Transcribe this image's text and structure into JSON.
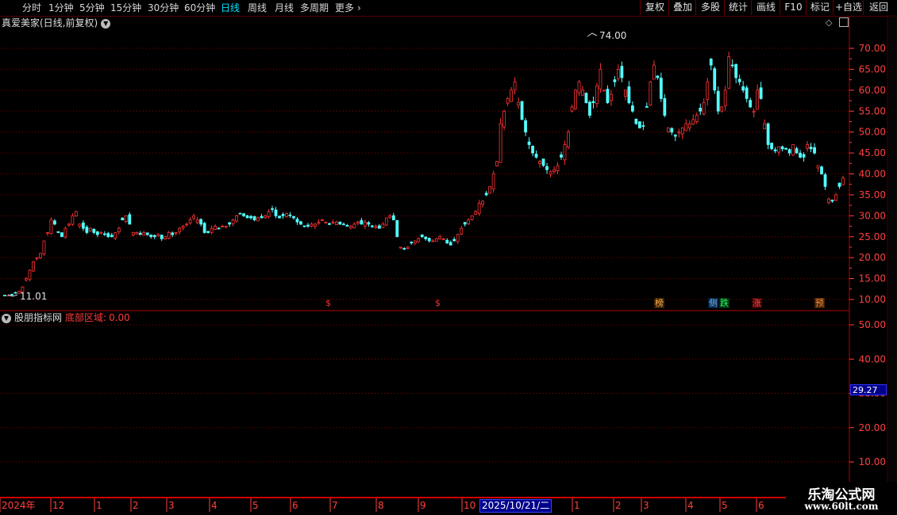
{
  "toolbar": {
    "periods": [
      "分时",
      "1分钟",
      "5分钟",
      "15分钟",
      "30分钟",
      "60分钟",
      "日线",
      "周线",
      "月线",
      "多周期",
      "更多"
    ],
    "active_period": "日线",
    "right_buttons": [
      "复权",
      "叠加",
      "多股",
      "统计",
      "画线",
      "F10",
      "标记",
      "+自选",
      "返回"
    ]
  },
  "main_chart": {
    "stock_title": "真爱美家(日线,前复权)",
    "high_label": "74.00",
    "low_label": "11.01",
    "markers": [
      {
        "text": "$",
        "color": "#ff3030"
      },
      {
        "text": "$",
        "color": "#ff3030"
      },
      {
        "text": "榜",
        "color": "#ffb050"
      },
      {
        "text": "侧",
        "color": "#80c0ff"
      },
      {
        "text": "跌",
        "color": "#30ff60"
      },
      {
        "text": "涨",
        "color": "#ff5050"
      },
      {
        "text": "预",
        "color": "#ff9040"
      }
    ]
  },
  "indicator": {
    "name": "股朋指标网",
    "param_label": "底部区域:",
    "param_value": "0.00",
    "current_value": "29.27"
  },
  "date_axis": {
    "labels": [
      "2024年",
      "12",
      "1",
      "2",
      "3",
      "4",
      "5",
      "6",
      "7",
      "8",
      "9",
      "10",
      "1",
      "2",
      "3",
      "4",
      "5",
      "6"
    ],
    "cursor_date": "2025/10/21/二"
  },
  "watermark": {
    "title": "乐淘公式网",
    "url": "www.60lt.com"
  },
  "colors": {
    "up": "#ff3232",
    "down": "#54ffff",
    "grid": "#8b0000",
    "axis": "#ff4040"
  },
  "chart_data": {
    "type": "candlestick",
    "price_axis": {
      "ticks": [
        10,
        15,
        20,
        25,
        30,
        35,
        40,
        45,
        50,
        55,
        60,
        65,
        70
      ],
      "ylim": [
        7.5,
        76
      ]
    },
    "indicator_axis": {
      "ticks": [
        10,
        20,
        30,
        40,
        50
      ]
    },
    "series_close_approx": [
      11,
      11,
      11.2,
      11.5,
      12,
      13,
      15,
      17,
      19,
      20,
      21,
      24,
      26,
      29,
      28,
      26,
      25,
      27,
      28,
      30,
      31,
      28,
      27,
      26,
      27,
      26,
      25.5,
      26,
      25.5,
      25,
      25,
      26,
      27,
      29,
      30,
      28,
      26,
      26,
      25.5,
      26,
      25.5,
      25,
      25,
      25.5,
      24.5,
      25,
      26,
      25.5,
      26,
      27,
      27.5,
      28,
      29,
      30,
      29,
      28,
      26,
      26,
      27,
      27.5,
      27,
      27.5,
      27.5,
      28,
      29,
      30,
      30.5,
      30,
      29.5,
      29.5,
      29,
      29.5,
      29.5,
      30,
      31,
      31.5,
      30,
      29.5,
      30,
      30.5,
      30,
      29.5,
      28.5,
      28,
      27.5,
      27.5,
      28,
      28,
      28.5,
      29,
      28.5,
      28,
      28.5,
      28.5,
      28,
      28,
      27.5,
      27.5,
      28,
      28.5,
      28,
      28.5,
      28,
      27.5,
      27.5,
      27,
      28,
      29.5,
      30,
      29,
      25,
      22.5,
      22,
      22.5,
      23.5,
      24,
      24.5,
      25,
      24.5,
      24,
      24,
      24.5,
      25,
      24.5,
      23.5,
      23,
      24,
      25.5,
      27,
      28,
      29,
      30,
      31,
      33,
      33.5,
      35,
      37,
      40,
      43,
      52,
      55,
      58,
      60,
      62,
      57,
      53,
      50,
      47,
      45,
      44,
      43,
      42,
      41,
      40.5,
      41,
      42,
      44,
      47,
      50,
      56,
      60,
      62,
      60,
      57,
      54,
      57,
      61,
      65,
      60,
      57,
      59,
      62,
      65,
      63,
      60,
      57,
      55,
      52,
      51,
      51.5,
      56,
      62,
      66,
      63,
      58,
      54,
      51,
      50,
      49,
      50,
      51,
      52,
      52,
      53,
      54,
      55,
      57,
      62,
      66,
      60,
      55,
      56,
      60,
      68,
      66,
      63,
      62,
      60,
      58,
      56,
      55,
      60,
      58,
      52,
      47,
      46,
      45.5,
      46.5,
      46,
      46,
      45,
      47,
      45,
      44,
      44,
      47,
      46,
      45,
      42,
      40,
      37,
      34,
      33.5,
      35,
      37,
      39
    ]
  }
}
